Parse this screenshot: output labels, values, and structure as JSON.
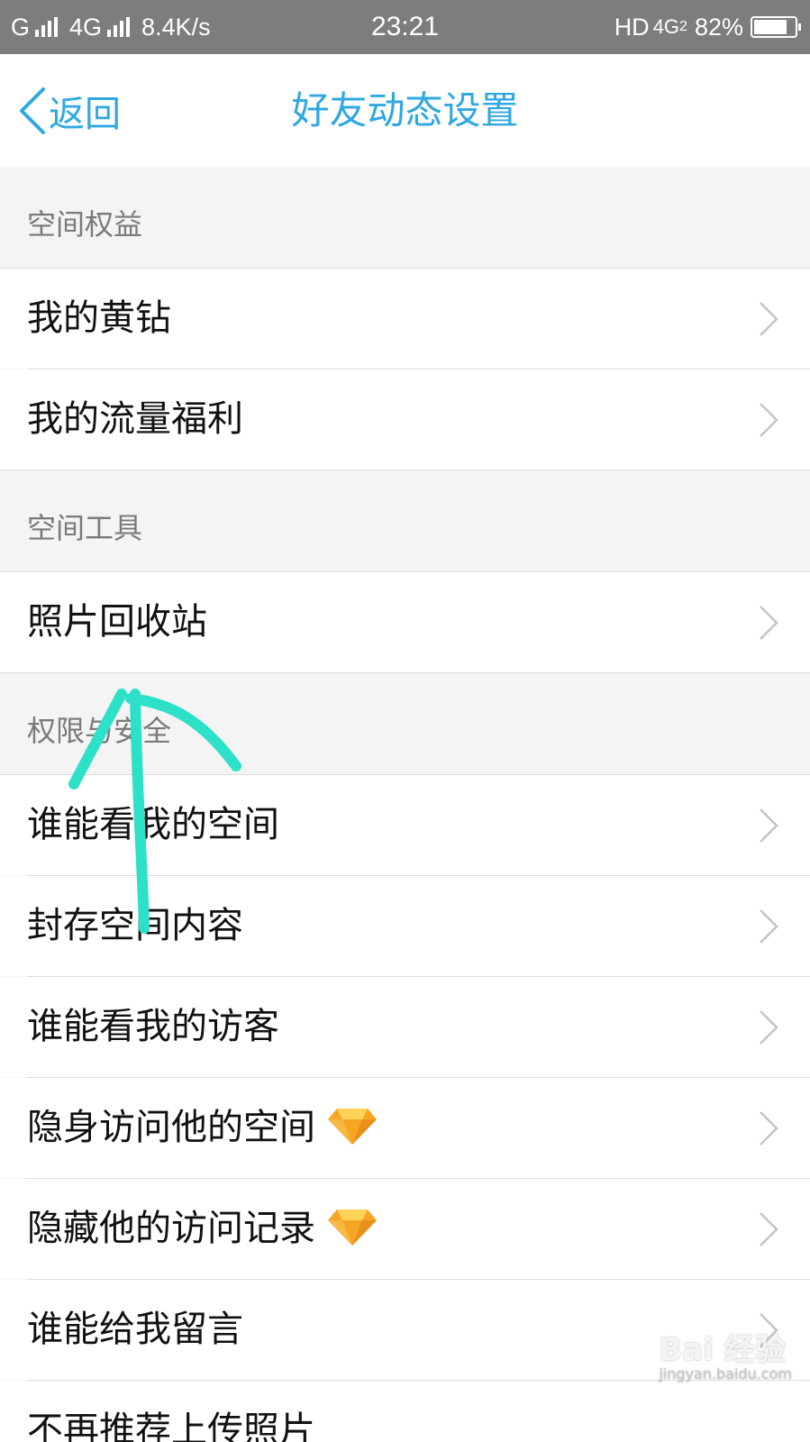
{
  "status_bar": {
    "carrier1": "G",
    "carrier2": "4G",
    "speed": "8.4K/s",
    "time": "23:21",
    "hd": "HD",
    "network": "4G",
    "network_sub": "2",
    "battery": "82%",
    "battery_level": 0.82
  },
  "nav": {
    "back_label": "返回",
    "title": "好友动态设置"
  },
  "sections": {
    "rights_title": "空间权益",
    "tools_title": "空间工具",
    "security_title": "权限与安全"
  },
  "items": {
    "yellow_diamond": "我的黄钻",
    "data_benefits": "我的流量福利",
    "photo_recycle": "照片回收站",
    "who_can_view_space": "谁能看我的空间",
    "seal_content": "封存空间内容",
    "who_can_view_visitors": "谁能看我的访客",
    "stealth_visit": "隐身访问他的空间",
    "hide_visit_record": "隐藏他的访问记录",
    "who_can_message": "谁能给我留言",
    "stop_recommend_upload": "不再推荐上传照片"
  },
  "watermark": {
    "text": "Bai 经验",
    "url": "jingyan.baidu.com"
  },
  "colors": {
    "accent": "#2fa8e0",
    "annotation": "#2de0c8",
    "gem": "#f5a623"
  }
}
